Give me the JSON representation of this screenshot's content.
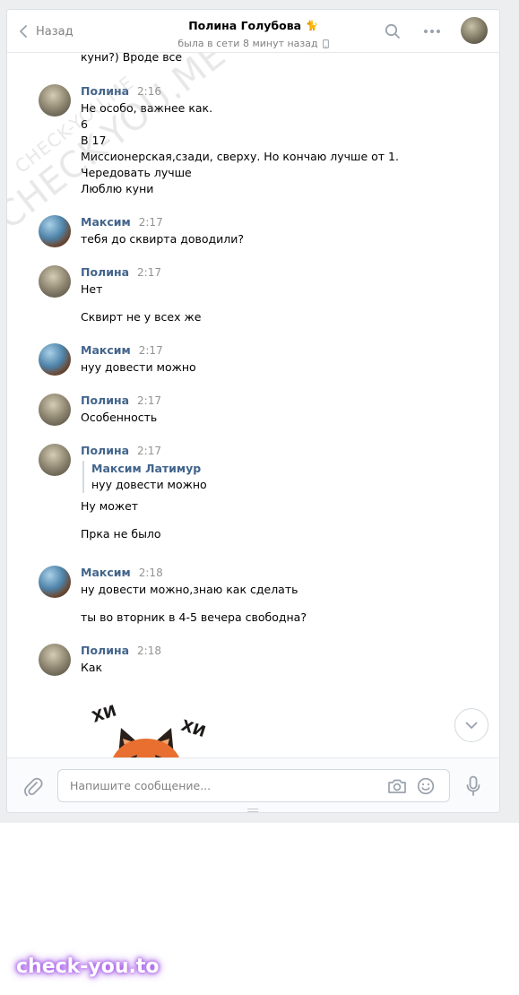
{
  "header": {
    "back_label": "Назад",
    "title": "Полина Голубова",
    "title_emoji": "🐈",
    "status": "была в сети 8 минут назад"
  },
  "top_fragment": "куни?) Вроде все",
  "messages": [
    {
      "author": "Полина",
      "time": "2:16",
      "lines": [
        "Не особо, важнее как.",
        "6",
        "В 17",
        "Миссионерская,сзади, сверху. Но кончаю лучше от 1.",
        "Чередовать лучше",
        "Люблю куни"
      ]
    },
    {
      "author": "Максим",
      "time": "2:17",
      "lines": [
        "тебя до сквирта доводили?"
      ]
    },
    {
      "author": "Полина",
      "time": "2:17",
      "lines": [
        "Нет",
        "Сквирт не у всех же"
      ]
    },
    {
      "author": "Максим",
      "time": "2:17",
      "lines": [
        "нуу довести можно"
      ]
    },
    {
      "author": "Полина",
      "time": "2:17",
      "lines": [
        "Особенность"
      ]
    },
    {
      "author": "Полина",
      "time": "2:17",
      "quote": {
        "author": "Максим Латимур",
        "text": "нуу довести можно"
      },
      "lines": [
        "Ну может",
        "Прка не было"
      ]
    },
    {
      "author": "Максим",
      "time": "2:18",
      "lines": [
        "ну довести можно,знаю как сделать",
        "ты во вторник в 4-5 вечера свободна?"
      ]
    },
    {
      "author": "Полина",
      "time": "2:18",
      "lines": [
        "Как"
      ]
    }
  ],
  "sticker": {
    "left_text": "ХИ",
    "right_text": "ХИ"
  },
  "composer": {
    "placeholder": "Напишите сообщение..."
  },
  "watermark": "CHECK-YOU.ME",
  "footer_brand": "check-you.to",
  "colors": {
    "name": "#42648b",
    "time": "#939393",
    "brand_glow": "#a04ee6"
  }
}
